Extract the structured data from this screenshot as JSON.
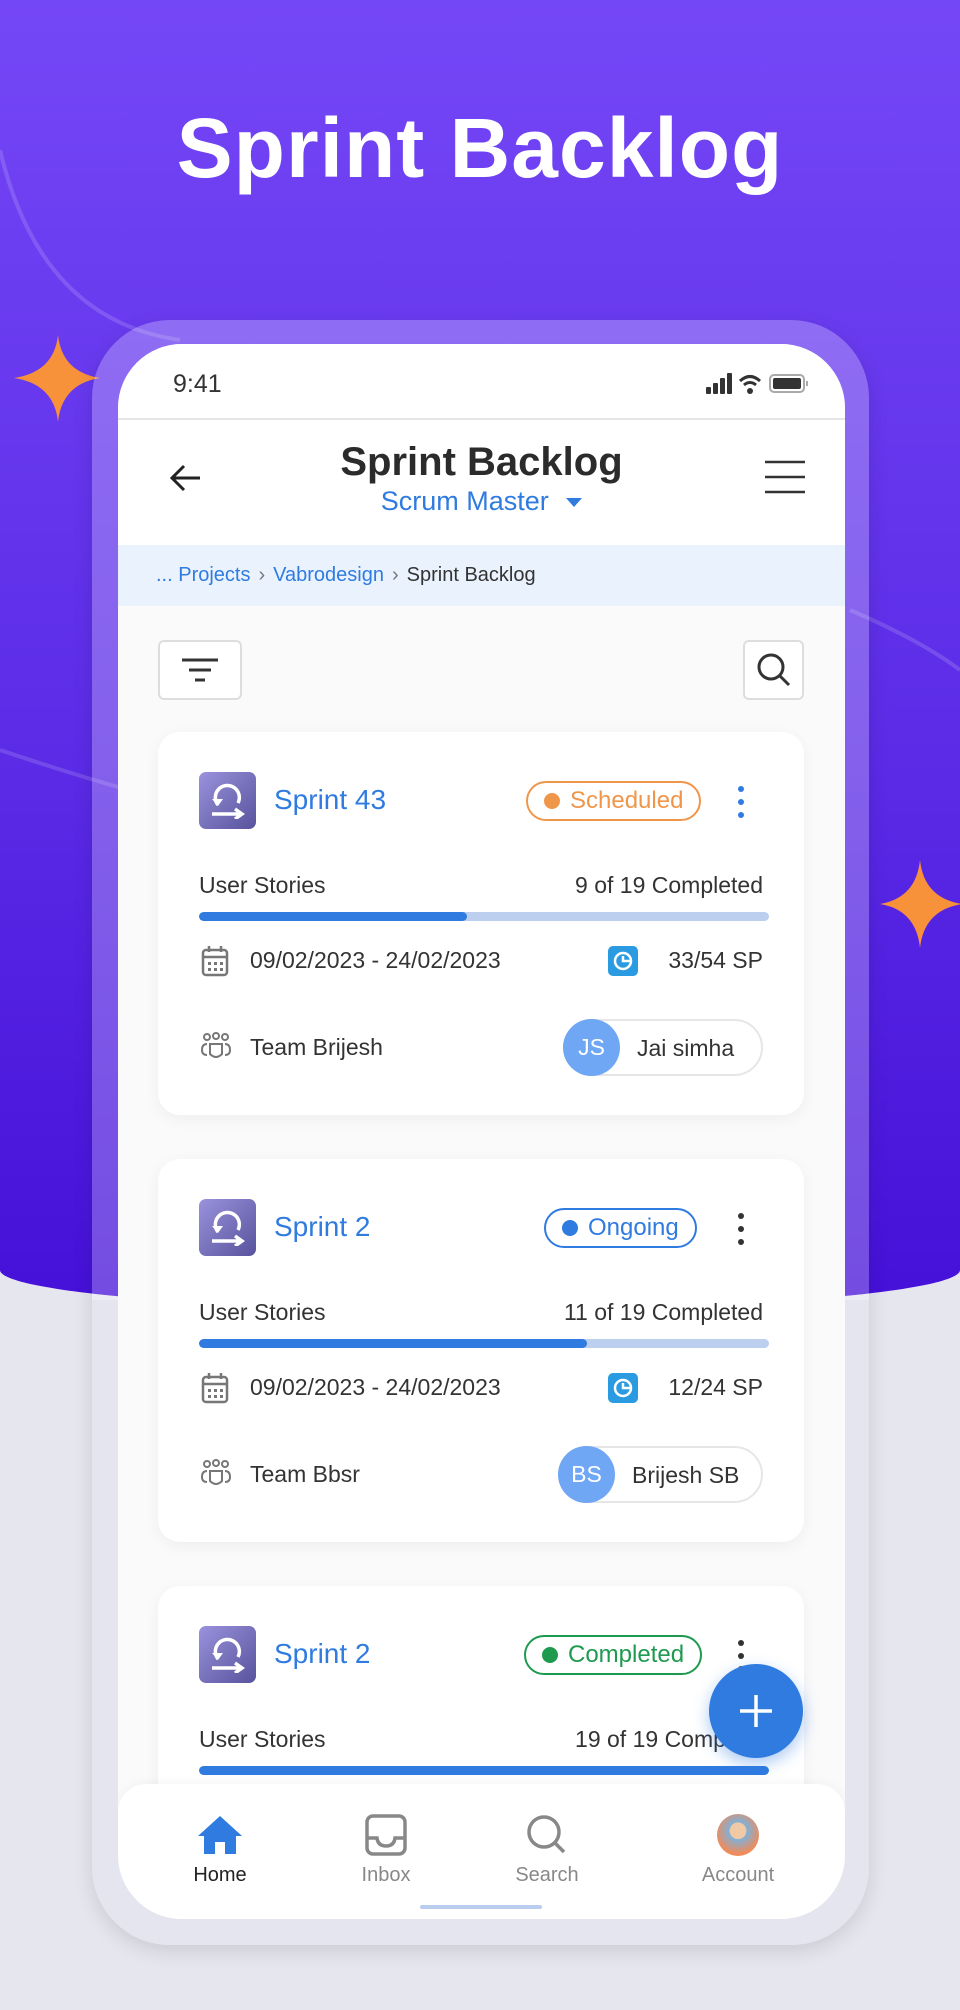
{
  "hero_title": "Sprint Backlog",
  "colors": {
    "accent": "#2f7be0",
    "scheduled": "#f0964a",
    "ongoing": "#2f7be0",
    "completed": "#1e9a4e",
    "sparkle": "#f7923a"
  },
  "status_bar": {
    "time": "9:41"
  },
  "header": {
    "title": "Sprint Backlog",
    "role": "Scrum Master"
  },
  "breadcrumb": [
    "... Projects",
    "Vabrodesign",
    "Sprint Backlog"
  ],
  "sprints": [
    {
      "name": "Sprint 43",
      "status": "Scheduled",
      "stories_label": "User Stories",
      "completed_text": "9 of 19 Completed",
      "progress": 0.47,
      "dates": "09/02/2023 - 24/02/2023",
      "sp": "33/54 SP",
      "team": "Team Brijesh",
      "assignee_initials": "JS",
      "assignee": "Jai simha"
    },
    {
      "name": "Sprint 2",
      "status": "Ongoing",
      "stories_label": "User Stories",
      "completed_text": "11 of 19 Completed",
      "progress": 0.68,
      "dates": "09/02/2023 - 24/02/2023",
      "sp": "12/24 SP",
      "team": "Team Bbsr",
      "assignee_initials": "BS",
      "assignee": "Brijesh SB"
    },
    {
      "name": "Sprint 2",
      "status": "Completed",
      "stories_label": "User Stories",
      "completed_text": "19 of 19 Complete",
      "progress": 1.0
    }
  ],
  "nav": {
    "home": "Home",
    "inbox": "Inbox",
    "search": "Search",
    "account": "Account"
  }
}
